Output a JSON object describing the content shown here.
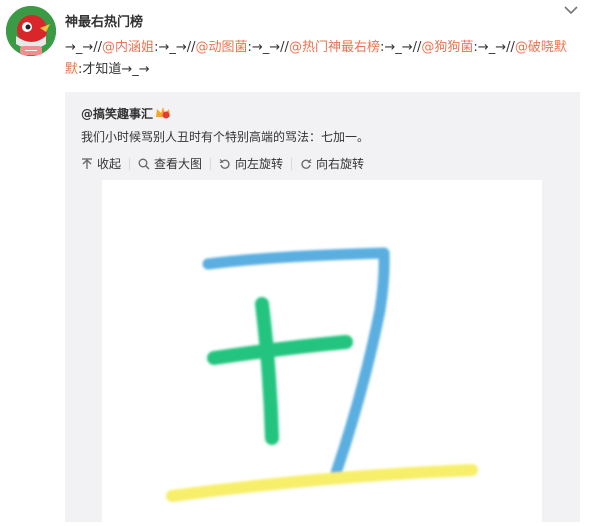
{
  "user": {
    "name": "神最右热门榜"
  },
  "post": {
    "segments": [
      {
        "text": "→_→//",
        "type": "text"
      },
      {
        "text": "@内涵姐",
        "type": "mention"
      },
      {
        "text": ":→_→//",
        "type": "text"
      },
      {
        "text": "@动图菌",
        "type": "mention"
      },
      {
        "text": ":→_→//",
        "type": "text"
      },
      {
        "text": "@热门神最右榜",
        "type": "mention"
      },
      {
        "text": ":→_→//",
        "type": "text"
      },
      {
        "text": "@狗狗菌",
        "type": "mention"
      },
      {
        "text": ":→_→//",
        "type": "text"
      },
      {
        "text": "@破晓默默",
        "type": "mention"
      },
      {
        "text": ":才知道→_→",
        "type": "text"
      }
    ]
  },
  "repost": {
    "author": "@搞笑趣事汇",
    "text": "我们小时候骂别人丑时有个特别高端的骂法：七加一。",
    "tools": {
      "collapse": "收起",
      "view_large": "查看大图",
      "rotate_left": "向左旋转",
      "rotate_right": "向右旋转"
    }
  },
  "colors": {
    "mention": "#eb7350",
    "repost_bg": "#f2f2f5",
    "stroke_blue": "#5aaee0",
    "stroke_green": "#22c47f",
    "stroke_yellow": "#f7ef6a"
  }
}
